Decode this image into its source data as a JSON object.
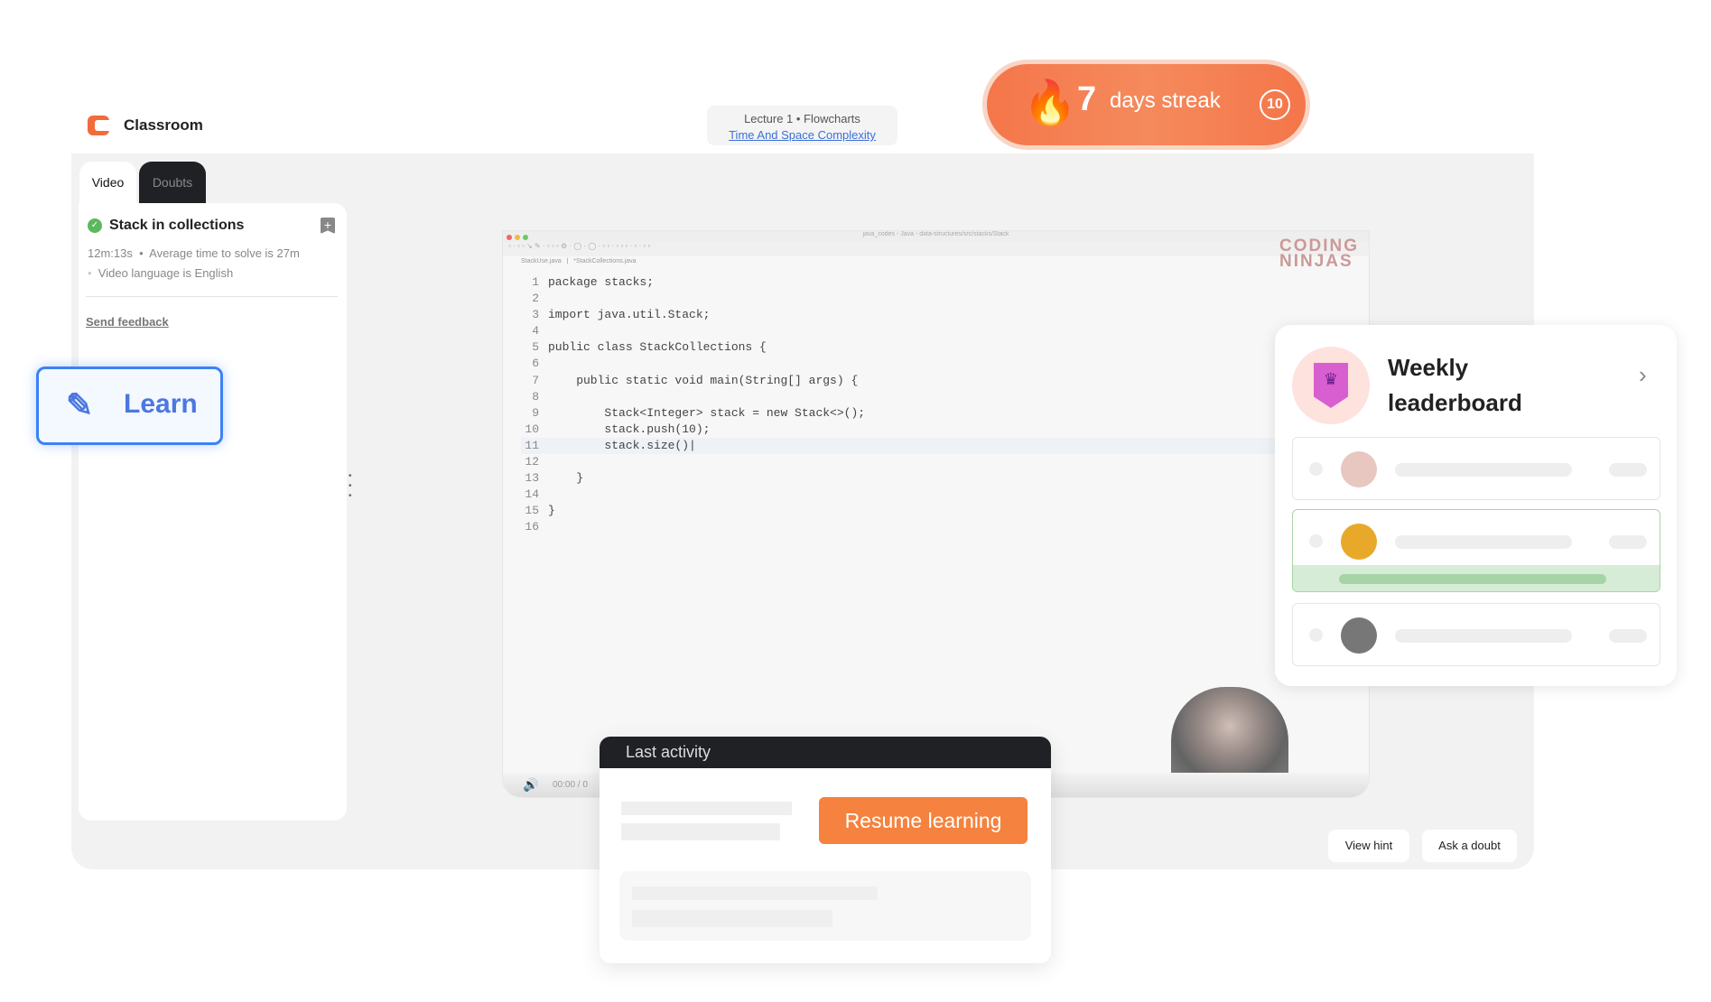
{
  "app": {
    "title": "Classroom",
    "logo_icon": "coding-ninjas-logo"
  },
  "lecture": {
    "line": "Lecture 1 • Flowcharts",
    "link": "Time And Space Complexity"
  },
  "streak": {
    "count": "7",
    "label": "days streak",
    "badge": "10",
    "icon": "flame-icon"
  },
  "tabs": [
    {
      "label": "Video",
      "active": true
    },
    {
      "label": "Doubts",
      "active": false
    }
  ],
  "problem": {
    "title": "Stack in collections",
    "status": "completed",
    "meta_time": "12m:13s",
    "meta_avg": "Average time to solve is 27m",
    "meta_lang": "Video language is English",
    "feedback": "Send feedback"
  },
  "learn_button": {
    "label": "Learn",
    "icon": "pencil-icon"
  },
  "video": {
    "window_title": "java_codes - Java - data-structures/src/stacks/Stack",
    "file_tabs": [
      "StackUse.java",
      "*StackCollections.java"
    ],
    "watermark": "CODING NINJAS",
    "time": "00:00 / 0",
    "code": [
      {
        "n": "1",
        "t": "package stacks;"
      },
      {
        "n": "2",
        "t": ""
      },
      {
        "n": "3",
        "t": "import java.util.Stack;"
      },
      {
        "n": "4",
        "t": ""
      },
      {
        "n": "5",
        "t": "public class StackCollections {"
      },
      {
        "n": "6",
        "t": ""
      },
      {
        "n": "7",
        "t": "    public static void main(String[] args) {"
      },
      {
        "n": "8",
        "t": ""
      },
      {
        "n": "9",
        "t": "        Stack<Integer> stack = new Stack<>();"
      },
      {
        "n": "10",
        "t": "        stack.push(10);"
      },
      {
        "n": "11",
        "t": "        stack.size()|"
      },
      {
        "n": "12",
        "t": ""
      },
      {
        "n": "13",
        "t": "    }"
      },
      {
        "n": "14",
        "t": ""
      },
      {
        "n": "15",
        "t": "}"
      },
      {
        "n": "16",
        "t": ""
      }
    ]
  },
  "leaderboard": {
    "title_line1": "Weekly",
    "title_line2": "leaderboard",
    "progress_percent": 80,
    "colors": {
      "highlight": "#a6d6a6"
    }
  },
  "last_activity": {
    "title": "Last activity",
    "resume": "Resume learning"
  },
  "actions": {
    "view_hint": "View hint",
    "ask_doubt": "Ask a doubt"
  },
  "colors": {
    "accent": "#f5823e",
    "streak": "#f5764a",
    "learn": "#3b82f6"
  }
}
